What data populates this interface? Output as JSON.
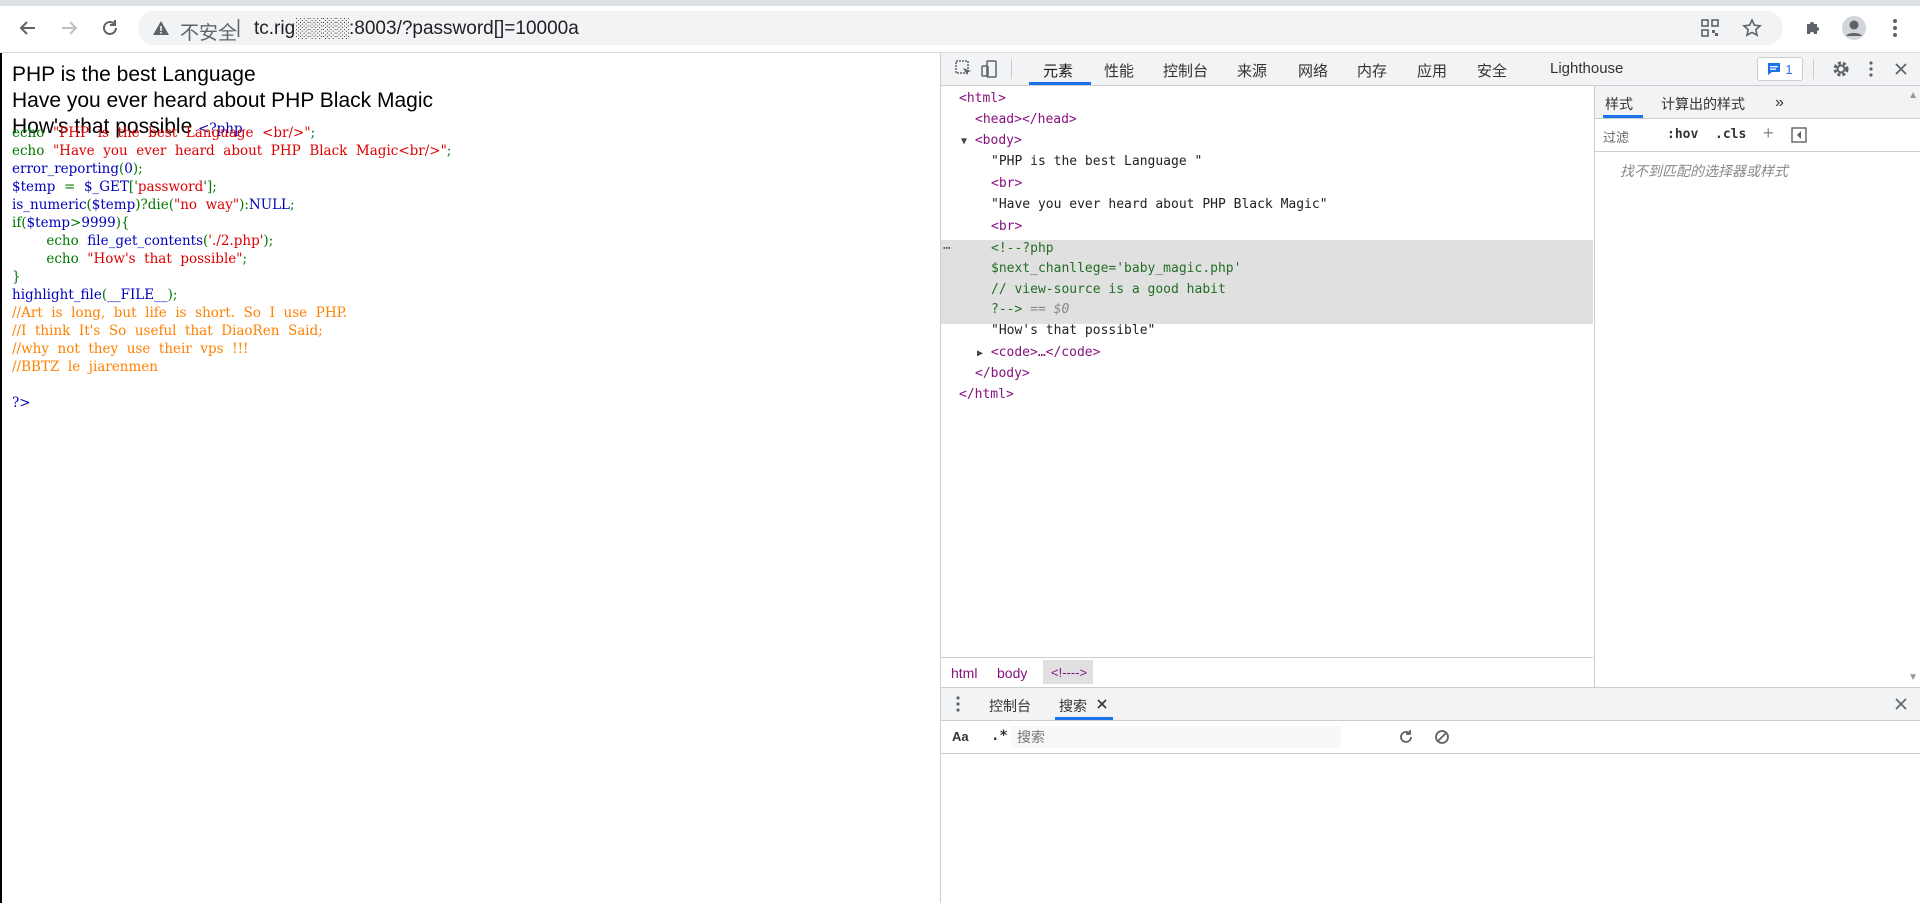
{
  "browser": {
    "security_label": "不安全",
    "separator": "|",
    "url": "tc.rig░░░░:8003/?password[]=10000a"
  },
  "page": {
    "lines": [
      "PHP is the best Language",
      "Have you ever heard about PHP Black Magic",
      "How's that possible"
    ],
    "php_open_tag": "<?php"
  },
  "source_code": [
    [
      {
        "t": "echo  ",
        "c": "g"
      },
      {
        "t": "\"PHP  is  the  best  Language  <br/>\"",
        "c": "s"
      },
      {
        "t": ";",
        "c": "g"
      }
    ],
    [
      {
        "t": "echo  ",
        "c": "g"
      },
      {
        "t": "\"Have  you  ever  heard  about  PHP  Black  Magic<br/>\"",
        "c": "s"
      },
      {
        "t": ";",
        "c": "g"
      }
    ],
    [
      {
        "t": "error_reporting",
        "c": "k"
      },
      {
        "t": "(",
        "c": "g"
      },
      {
        "t": "0",
        "c": "k"
      },
      {
        "t": ");",
        "c": "g"
      }
    ],
    [
      {
        "t": "$temp  ",
        "c": "k"
      },
      {
        "t": "=  ",
        "c": "g"
      },
      {
        "t": "$_GET",
        "c": "k"
      },
      {
        "t": "['",
        "c": "g"
      },
      {
        "t": "password",
        "c": "s"
      },
      {
        "t": "'];",
        "c": "g"
      }
    ],
    [
      {
        "t": "is_numeric",
        "c": "k"
      },
      {
        "t": "(",
        "c": "g"
      },
      {
        "t": "$temp",
        "c": "k"
      },
      {
        "t": ")?",
        "c": "g"
      },
      {
        "t": "die",
        "c": "g"
      },
      {
        "t": "(",
        "c": "g"
      },
      {
        "t": "\"no  way\"",
        "c": "s"
      },
      {
        "t": "):",
        "c": "g"
      },
      {
        "t": "NULL",
        "c": "k"
      },
      {
        "t": ";",
        "c": "g"
      }
    ],
    [
      {
        "t": "if(",
        "c": "g"
      },
      {
        "t": "$temp",
        "c": "k"
      },
      {
        "t": ">",
        "c": "g"
      },
      {
        "t": "9999",
        "c": "k"
      },
      {
        "t": "){",
        "c": "g"
      }
    ],
    [
      {
        "t": "        echo  ",
        "c": "g"
      },
      {
        "t": "file_get_contents",
        "c": "k"
      },
      {
        "t": "(",
        "c": "g"
      },
      {
        "t": "'./2.php'",
        "c": "s"
      },
      {
        "t": ");",
        "c": "g"
      }
    ],
    [
      {
        "t": "        echo  ",
        "c": "g"
      },
      {
        "t": "\"How's  that  possible\"",
        "c": "s"
      },
      {
        "t": ";",
        "c": "g"
      }
    ],
    [
      {
        "t": "}",
        "c": "g"
      }
    ],
    [
      {
        "t": "highlight_file",
        "c": "k"
      },
      {
        "t": "(",
        "c": "g"
      },
      {
        "t": "__FILE__",
        "c": "k"
      },
      {
        "t": ");",
        "c": "g"
      }
    ],
    [
      {
        "t": "//Art  is  long,  but  life  is  short.  So  I  use  PHP.",
        "c": "c"
      }
    ],
    [
      {
        "t": "//I  think  It's  So  useful  that  DiaoRen  Said;",
        "c": "c"
      }
    ],
    [
      {
        "t": "//why  not  they  use  their  vps  !!!",
        "c": "c"
      }
    ],
    [
      {
        "t": "//BBTZ  le  jiarenmen",
        "c": "c"
      }
    ],
    [
      {
        "t": "",
        "c": "k"
      }
    ],
    [
      {
        "t": "?>",
        "c": "k"
      }
    ]
  ],
  "devtools": {
    "tabs": [
      "元素",
      "性能",
      "控制台",
      "来源",
      "网络",
      "内存",
      "应用",
      "安全",
      "Lighthouse"
    ],
    "issues_count": "1",
    "dom_tree": {
      "html_open": "<html>",
      "head": "<head></head>",
      "body_open": "<body>",
      "text1": "\"PHP is the best Language \"",
      "br1": "<br>",
      "text2": "\"Have you ever heard about PHP Black Magic\"",
      "br2": "<br>",
      "comment1": "<!--?php",
      "comment2": "$next_chanllege='baby_magic.php'",
      "comment3": "// view-source is a good habit",
      "comment4": "?-->",
      "eq0": " == $0",
      "ellipsis": "⋯",
      "text3": "\"How's that possible\"",
      "code": "<code>…</code>",
      "body_close": "</body>",
      "html_close": "</html>"
    },
    "breadcrumb": [
      "html",
      "body",
      "<!---->"
    ],
    "styles": {
      "tabs": [
        "样式",
        "计算出的样式"
      ],
      "filter_placeholder": "过滤",
      "hov": ":hov",
      "cls": ".cls",
      "no_match": "找不到匹配的选择器或样式"
    },
    "drawer": {
      "tabs": [
        "控制台",
        "搜索"
      ],
      "aa": "Aa",
      "regex": ".*",
      "search_placeholder": "搜索"
    }
  }
}
